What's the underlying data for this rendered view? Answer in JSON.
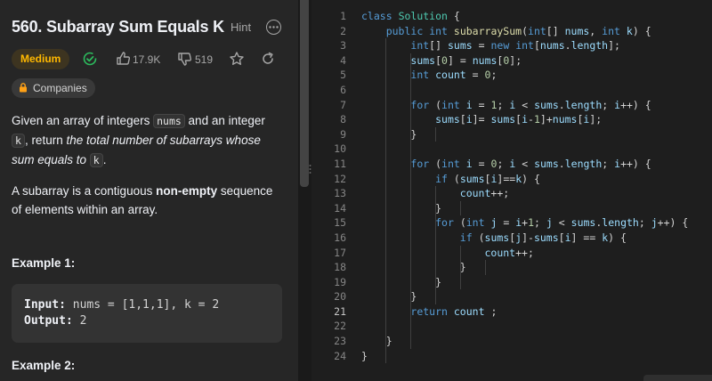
{
  "problem": {
    "title": "560. Subarray Sum Equals K",
    "hint_label": "Hint",
    "difficulty": "Medium",
    "likes": "17.9K",
    "dislikes": "519",
    "companies_label": "Companies"
  },
  "description": {
    "p1_a": "Given an array of integers ",
    "p1_code1": "nums",
    "p1_b": " and an integer ",
    "p1_code2": "k",
    "p1_c": ", return ",
    "p1_italic": "the total number of subarrays whose sum equals to ",
    "p1_code3": "k",
    "p1_d": ".",
    "p2_a": "A subarray is a contiguous ",
    "p2_bold": "non-empty",
    "p2_b": " sequence of elements within an array."
  },
  "examples": {
    "ex1_title": "Example 1:",
    "ex1_input_label": "Input:",
    "ex1_input": " nums = [1,1,1], k = 2",
    "ex1_output_label": "Output:",
    "ex1_output": " 2",
    "ex2_title": "Example 2:"
  },
  "editor": {
    "active_line": 21,
    "lines": [
      "class Solution {",
      "    public int subarraySum(int[] nums, int k) {",
      "        int[] sums = new int[nums.length];",
      "        sums[0] = nums[0];",
      "        int count = 0;",
      "",
      "        for (int i = 1; i < sums.length; i++) {",
      "            sums[i]= sums[i-1]+nums[i];",
      "        }",
      "",
      "        for (int i = 0; i < sums.length; i++) {",
      "            if (sums[i]==k) {",
      "                count++;",
      "            }",
      "            for (int j = i+1; j < sums.length; j++) {",
      "                if (sums[j]-sums[i] == k) {",
      "                    count++;",
      "                }",
      "            }",
      "        }",
      "        return count ;",
      "",
      "    }",
      "}"
    ]
  },
  "colors": {
    "panel_bg": "#262626",
    "editor_bg": "#1e1e1e",
    "medium": "#ffb800",
    "solved": "#2cbb5d",
    "keyword": "#569cd6"
  }
}
